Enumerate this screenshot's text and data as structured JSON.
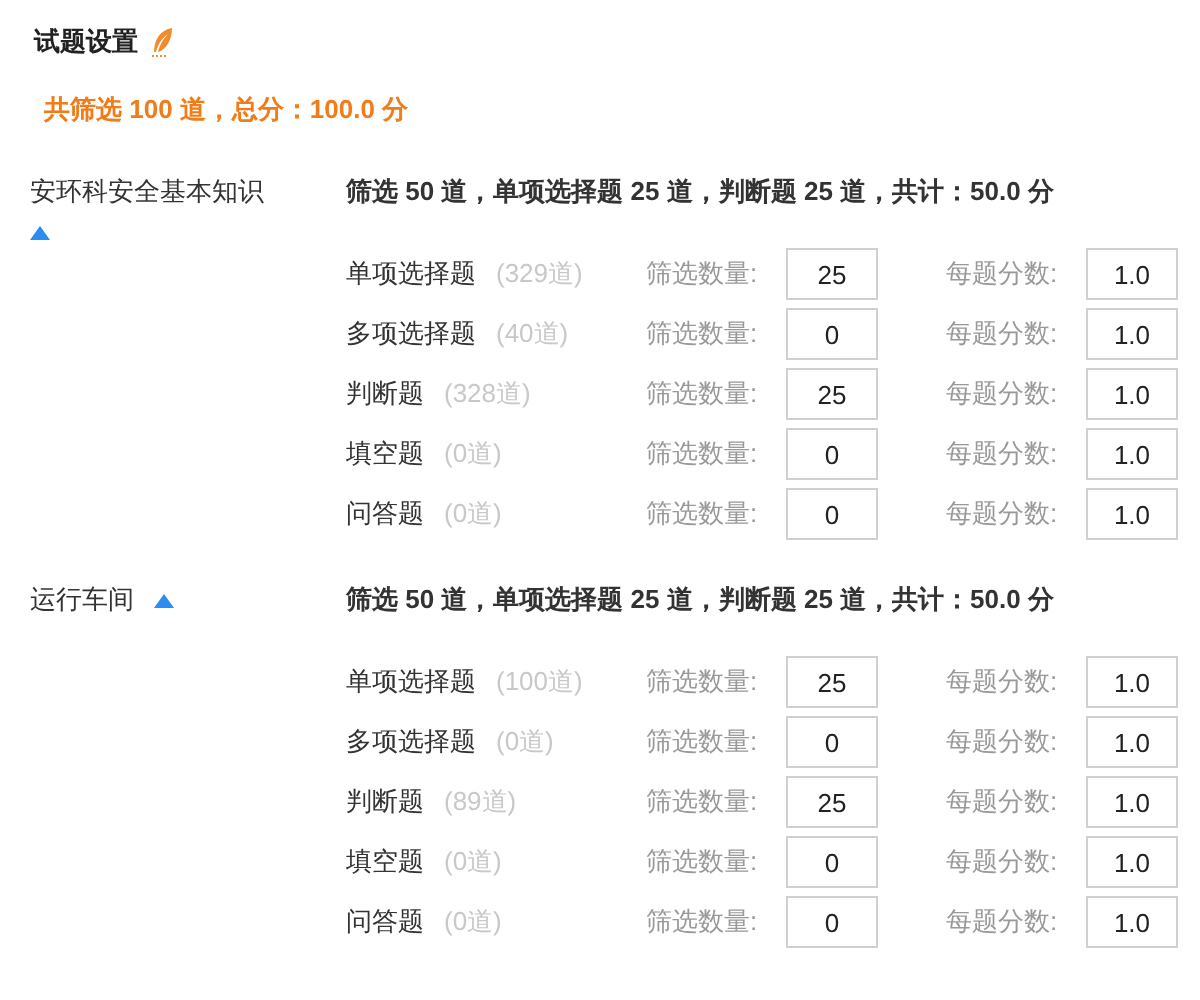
{
  "title": "试题设置",
  "total_summary": "共筛选 100 道，总分：100.0 分",
  "sections": [
    {
      "name": "安环科安全基本知识",
      "expanded": true,
      "summary": "筛选 50 道，单项选择题 25 道，判断题 25 道，共计：50.0 分",
      "rows": [
        {
          "type": "单项选择题",
          "count": "(329道)",
          "quantity_label": "筛选数量:",
          "quantity": "25",
          "score_label": "每题分数:",
          "score": "1.0"
        },
        {
          "type": "多项选择题",
          "count": "(40道)",
          "quantity_label": "筛选数量:",
          "quantity": "0",
          "score_label": "每题分数:",
          "score": "1.0"
        },
        {
          "type": "判断题",
          "count": "(328道)",
          "quantity_label": "筛选数量:",
          "quantity": "25",
          "score_label": "每题分数:",
          "score": "1.0"
        },
        {
          "type": "填空题",
          "count": "(0道)",
          "quantity_label": "筛选数量:",
          "quantity": "0",
          "score_label": "每题分数:",
          "score": "1.0"
        },
        {
          "type": "问答题",
          "count": "(0道)",
          "quantity_label": "筛选数量:",
          "quantity": "0",
          "score_label": "每题分数:",
          "score": "1.0"
        }
      ]
    },
    {
      "name": "运行车间",
      "expanded": true,
      "summary": "筛选 50 道，单项选择题 25 道，判断题 25 道，共计：50.0 分",
      "rows": [
        {
          "type": "单项选择题",
          "count": "(100道)",
          "quantity_label": "筛选数量:",
          "quantity": "25",
          "score_label": "每题分数:",
          "score": "1.0"
        },
        {
          "type": "多项选择题",
          "count": "(0道)",
          "quantity_label": "筛选数量:",
          "quantity": "0",
          "score_label": "每题分数:",
          "score": "1.0"
        },
        {
          "type": "判断题",
          "count": "(89道)",
          "quantity_label": "筛选数量:",
          "quantity": "25",
          "score_label": "每题分数:",
          "score": "1.0"
        },
        {
          "type": "填空题",
          "count": "(0道)",
          "quantity_label": "筛选数量:",
          "quantity": "0",
          "score_label": "每题分数:",
          "score": "1.0"
        },
        {
          "type": "问答题",
          "count": "(0道)",
          "quantity_label": "筛选数量:",
          "quantity": "0",
          "score_label": "每题分数:",
          "score": "1.0"
        }
      ]
    }
  ]
}
